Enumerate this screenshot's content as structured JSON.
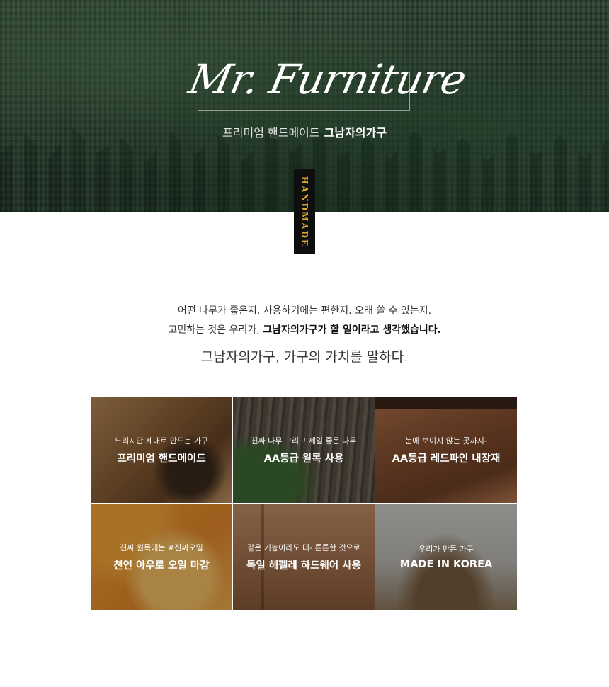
{
  "hero": {
    "logo": "Mr. Furniture",
    "tagline_light": "프리미엄 핸드메이드",
    "tagline_bold": "그남자의가구",
    "badge": "HANDMADE"
  },
  "intro": {
    "line1": "어떤 나무가 좋은지. 사용하기에는 편한지. 오래 쓸 수 있는지.",
    "line2_prefix": "고민하는 것은 우리가, ",
    "line2_bold": "그남자의가구가 할 일이라고 생각했습니다.",
    "line3": "그남자의가구,  가구의 가치를 말하다."
  },
  "features": [
    {
      "sub": "느리지만 제대로 만드는 가구",
      "main": "프리미엄 핸드메이드"
    },
    {
      "sub": "진짜 나무 그리고 제일 좋은 나무",
      "main": "AA등급 원목 사용"
    },
    {
      "sub": "눈에 보이지 않는 곳까지-",
      "main": "AA등급 레드파인 내장재"
    },
    {
      "sub": "진짜 원목에는 #진짜오일",
      "main": "천연 아우로 오일 마감"
    },
    {
      "sub": "같은 기능이라도 더- 튼튼한 것으로",
      "main": "독일 헤펠레 하드웨어 사용"
    },
    {
      "sub": "우리가 만든 가구",
      "main": "MADE IN KOREA"
    }
  ]
}
